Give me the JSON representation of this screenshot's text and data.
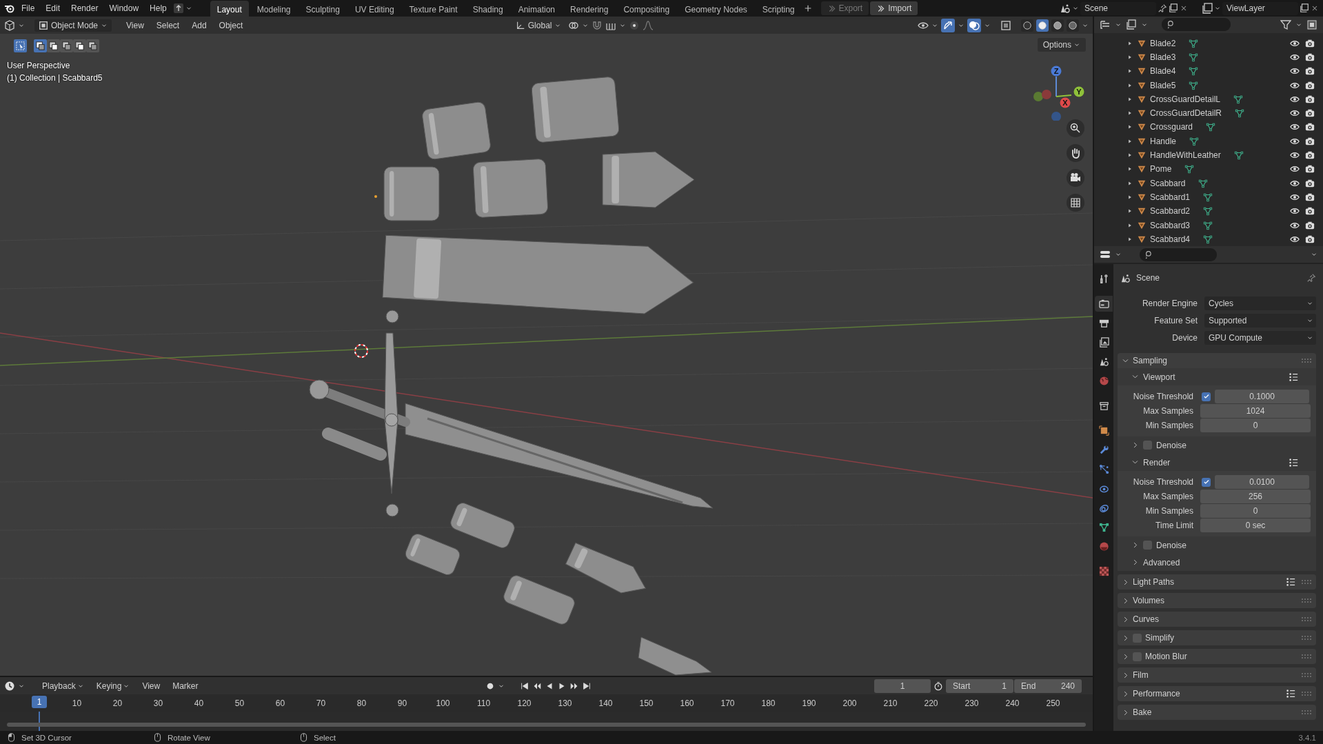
{
  "topbar": {
    "menus": [
      "File",
      "Edit",
      "Render",
      "Window",
      "Help"
    ],
    "workspaces": [
      {
        "label": "Layout",
        "selected": true
      },
      {
        "label": "Modeling",
        "selected": false
      },
      {
        "label": "Sculpting",
        "selected": false
      },
      {
        "label": "UV Editing",
        "selected": false
      },
      {
        "label": "Texture Paint",
        "selected": false
      },
      {
        "label": "Shading",
        "selected": false
      },
      {
        "label": "Animation",
        "selected": false
      },
      {
        "label": "Rendering",
        "selected": false
      },
      {
        "label": "Compositing",
        "selected": false
      },
      {
        "label": "Geometry Nodes",
        "selected": false
      },
      {
        "label": "Scripting",
        "selected": false
      }
    ],
    "actions": [
      {
        "label": "Export",
        "disabled": true
      },
      {
        "label": "Import",
        "disabled": false
      }
    ],
    "scene": "Scene",
    "view_layer": "ViewLayer"
  },
  "viewport": {
    "mode": "Object Mode",
    "menus": [
      "View",
      "Select",
      "Add",
      "Object"
    ],
    "orientation": "Global",
    "options": "Options",
    "overlay_title": "User Perspective",
    "overlay_subtitle": "(1) Collection | Scabbard5",
    "gizmo": {
      "x": "X",
      "y": "Y",
      "z": "Z"
    }
  },
  "outliner": {
    "items": [
      {
        "name": "Blade2"
      },
      {
        "name": "Blade3"
      },
      {
        "name": "Blade4"
      },
      {
        "name": "Blade5"
      },
      {
        "name": "CrossGuardDetailL"
      },
      {
        "name": "CrossGuardDetailR"
      },
      {
        "name": "Crossguard"
      },
      {
        "name": "Handle"
      },
      {
        "name": "HandleWithLeather"
      },
      {
        "name": "Pome"
      },
      {
        "name": "Scabbard"
      },
      {
        "name": "Scabbard1"
      },
      {
        "name": "Scabbard2"
      },
      {
        "name": "Scabbard3"
      },
      {
        "name": "Scabbard4"
      }
    ]
  },
  "properties": {
    "tabs": [
      {
        "selected": false
      },
      {
        "selected": true
      },
      {
        "selected": false
      },
      {
        "selected": false
      },
      {
        "selected": false
      },
      {
        "selected": false
      },
      {
        "selected": false
      },
      {
        "selected": false
      },
      {
        "selected": false
      },
      {
        "selected": false
      },
      {
        "selected": false
      },
      {
        "selected": false
      },
      {
        "selected": false
      },
      {
        "selected": false
      },
      {
        "selected": false
      }
    ],
    "context": "Scene",
    "settings": [
      {
        "label": "Render Engine",
        "value": "Cycles"
      },
      {
        "label": "Feature Set",
        "value": "Supported"
      },
      {
        "label": "Device",
        "value": "GPU Compute"
      }
    ],
    "panels": [
      {
        "title": "Sampling",
        "expanded": true,
        "subpanels": [
          {
            "title": "Viewport",
            "expanded": true,
            "presets": true,
            "rows": [
              {
                "label": "Noise Threshold",
                "kind": "toggle_number",
                "checked": true,
                "value": "0.1000"
              },
              {
                "label": "Max Samples",
                "kind": "number",
                "value": "1024"
              },
              {
                "label": "Min Samples",
                "kind": "number",
                "value": "0"
              }
            ]
          },
          {
            "title": "Denoise",
            "expanded": false,
            "checked": false
          },
          {
            "title": "Render",
            "expanded": true,
            "presets": true,
            "rows": [
              {
                "label": "Noise Threshold",
                "kind": "toggle_number",
                "checked": true,
                "value": "0.0100"
              },
              {
                "label": "Max Samples",
                "kind": "number",
                "value": "256"
              },
              {
                "label": "Min Samples",
                "kind": "number",
                "value": "0"
              },
              {
                "label": "Time Limit",
                "kind": "number",
                "value": "0 sec"
              }
            ]
          },
          {
            "title": "Denoise",
            "expanded": false,
            "checked": false
          },
          {
            "title": "Advanced",
            "expanded": false
          }
        ]
      },
      {
        "title": "Light Paths",
        "expanded": false,
        "presets": true
      },
      {
        "title": "Volumes",
        "expanded": false
      },
      {
        "title": "Curves",
        "expanded": false
      },
      {
        "title": "Simplify",
        "expanded": false,
        "checked": false
      },
      {
        "title": "Motion Blur",
        "expanded": false,
        "checked": false
      },
      {
        "title": "Film",
        "expanded": false
      },
      {
        "title": "Performance",
        "expanded": false,
        "presets": true
      },
      {
        "title": "Bake",
        "expanded": false
      }
    ]
  },
  "timeline": {
    "menus": [
      {
        "label": "Playback",
        "dropdown": true
      },
      {
        "label": "Keying",
        "dropdown": true
      },
      {
        "label": "View",
        "dropdown": false
      },
      {
        "label": "Marker",
        "dropdown": false
      }
    ],
    "current_frame": "1",
    "start_label": "Start",
    "start": "1",
    "end_label": "End",
    "end": "240",
    "playhead": "1",
    "ruler": [
      "10",
      "20",
      "30",
      "40",
      "50",
      "60",
      "70",
      "80",
      "90",
      "100",
      "110",
      "120",
      "130",
      "140",
      "150",
      "160",
      "170",
      "180",
      "190",
      "200",
      "210",
      "220",
      "230",
      "240",
      "250"
    ]
  },
  "status_bar": {
    "hints": [
      "Set 3D Cursor",
      "Rotate View",
      "Select"
    ],
    "version": "3.4.1"
  }
}
